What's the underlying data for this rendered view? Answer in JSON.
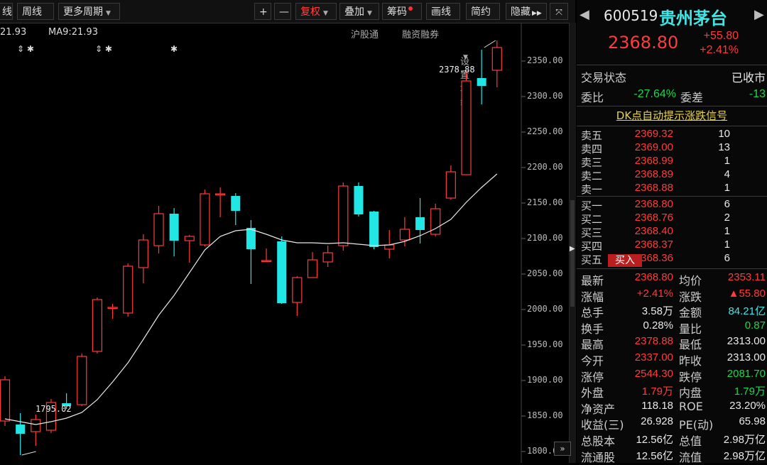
{
  "toolbar": {
    "items": [
      "线",
      "周线",
      "更多周期",
      "+",
      "—",
      "复权",
      "叠加",
      "筹码",
      "画线",
      "简约",
      "隐藏"
    ],
    "expand_glyph": "▶▶"
  },
  "indicators": {
    "close_readout": "21.93",
    "ma_readout": "MA9:21.93",
    "links": [
      "沪股通",
      "融资融券",
      "设置均线"
    ]
  },
  "chart_data": {
    "type": "candlestick",
    "y_ticks": [
      "2350.00",
      "2300.00",
      "2250.00",
      "2200.00",
      "2150.00",
      "2100.00",
      "2050.00",
      "2000.00",
      "1950.00",
      "1900.00",
      "1850.00",
      "1800.00"
    ],
    "ylim": [
      1784,
      2404
    ],
    "high_note": "2378.88",
    "low_note": "1795.02",
    "candles": [
      {
        "o": 1843,
        "h": 1906,
        "l": 1836,
        "c": 1901
      },
      {
        "o": 1838,
        "h": 1854,
        "l": 1795,
        "c": 1825
      },
      {
        "o": 1828,
        "h": 1852,
        "l": 1808,
        "c": 1845
      },
      {
        "o": 1830,
        "h": 1874,
        "l": 1826,
        "c": 1869
      },
      {
        "o": 1868,
        "h": 1882,
        "l": 1860,
        "c": 1864
      },
      {
        "o": 1866,
        "h": 1938,
        "l": 1864,
        "c": 1934
      },
      {
        "o": 1941,
        "h": 2017,
        "l": 1938,
        "c": 2014
      },
      {
        "o": 2003,
        "h": 2008,
        "l": 1987,
        "c": 2003
      },
      {
        "o": 1995,
        "h": 2065,
        "l": 1990,
        "c": 2061
      },
      {
        "o": 2059,
        "h": 2106,
        "l": 2037,
        "c": 2098
      },
      {
        "o": 2090,
        "h": 2146,
        "l": 2079,
        "c": 2135
      },
      {
        "o": 2135,
        "h": 2143,
        "l": 2075,
        "c": 2097
      },
      {
        "o": 2097,
        "h": 2105,
        "l": 2066,
        "c": 2103
      },
      {
        "o": 2091,
        "h": 2169,
        "l": 2089,
        "c": 2163
      },
      {
        "o": 2162,
        "h": 2172,
        "l": 2130,
        "c": 2163
      },
      {
        "o": 2160,
        "h": 2164,
        "l": 2119,
        "c": 2139
      },
      {
        "o": 2115,
        "h": 2126,
        "l": 2036,
        "c": 2085
      },
      {
        "o": 2069,
        "h": 2086,
        "l": 2069,
        "c": 2069
      },
      {
        "o": 2096,
        "h": 2103,
        "l": 2008,
        "c": 2009
      },
      {
        "o": 2010,
        "h": 2047,
        "l": 1991,
        "c": 2045
      },
      {
        "o": 2045,
        "h": 2081,
        "l": 2045,
        "c": 2070
      },
      {
        "o": 2067,
        "h": 2090,
        "l": 2060,
        "c": 2080
      },
      {
        "o": 2090,
        "h": 2179,
        "l": 2083,
        "c": 2174
      },
      {
        "o": 2174,
        "h": 2179,
        "l": 2131,
        "c": 2134
      },
      {
        "o": 2138,
        "h": 2139,
        "l": 2085,
        "c": 2088
      },
      {
        "o": 2085,
        "h": 2112,
        "l": 2072,
        "c": 2091
      },
      {
        "o": 2098,
        "h": 2130,
        "l": 2089,
        "c": 2113
      },
      {
        "o": 2130,
        "h": 2157,
        "l": 2093,
        "c": 2112
      },
      {
        "o": 2106,
        "h": 2149,
        "l": 2103,
        "c": 2142
      },
      {
        "o": 2157,
        "h": 2203,
        "l": 2155,
        "c": 2194
      },
      {
        "o": 2190,
        "h": 2334,
        "l": 2190,
        "c": 2322
      },
      {
        "o": 2326,
        "h": 2366,
        "l": 2289,
        "c": 2315
      },
      {
        "o": 2337,
        "h": 2379,
        "l": 2313,
        "c": 2369
      }
    ],
    "ma": [
      1846,
      1842,
      1838,
      1842,
      1847,
      1855,
      1873,
      1898,
      1925,
      1958,
      1992,
      2020,
      2052,
      2084,
      2103,
      2111,
      2113,
      2106,
      2098,
      2094,
      2094,
      2093,
      2094,
      2092,
      2090,
      2091,
      2096,
      2104,
      2114,
      2127,
      2151,
      2172,
      2191
    ]
  },
  "quote": {
    "code": "600519",
    "name": "贵州茅台",
    "price": "2368.80",
    "change": "+55.80",
    "change_pct": "+2.41%",
    "status_label": "交易状态",
    "status_value": "已收市",
    "weibi_label": "委比",
    "weibi_value": "-27.64%",
    "weicha_label": "委差",
    "weicha_value": "-13",
    "signal_link": "DK点自动提示涨跌信号"
  },
  "order_book": {
    "sell": [
      {
        "label": "卖五",
        "price": "2369.32",
        "vol": "10"
      },
      {
        "label": "卖四",
        "price": "2369.00",
        "vol": "13"
      },
      {
        "label": "卖三",
        "price": "2368.99",
        "vol": "1"
      },
      {
        "label": "卖二",
        "price": "2368.89",
        "vol": "4"
      },
      {
        "label": "卖一",
        "price": "2368.88",
        "vol": "1"
      }
    ],
    "buy": [
      {
        "label": "买一",
        "price": "2368.80",
        "vol": "6"
      },
      {
        "label": "买二",
        "price": "2368.76",
        "vol": "2"
      },
      {
        "label": "买三",
        "price": "2368.40",
        "vol": "1"
      },
      {
        "label": "买四",
        "price": "2368.37",
        "vol": "1"
      },
      {
        "label": "买五",
        "price": "2368.36",
        "vol": "6"
      }
    ],
    "buy_button": "买入"
  },
  "stats": [
    {
      "l1": "最新",
      "v1": "2368.80",
      "c1": "red",
      "l2": "均价",
      "v2": "2353.11",
      "c2": "red"
    },
    {
      "l1": "涨幅",
      "v1": "+2.41%",
      "c1": "red",
      "l2": "涨跌",
      "v2": "▲55.80",
      "c2": "red"
    },
    {
      "l1": "总手",
      "v1": "3.58万",
      "c1": "white",
      "l2": "金额",
      "v2": "84.21亿",
      "c2": "cyan"
    },
    {
      "l1": "换手",
      "v1": "0.28%",
      "c1": "white",
      "l2": "量比",
      "v2": "0.87",
      "c2": "green"
    },
    {
      "l1": "最高",
      "v1": "2378.88",
      "c1": "red",
      "l2": "最低",
      "v2": "2313.00",
      "c2": "white"
    },
    {
      "l1": "今开",
      "v1": "2337.00",
      "c1": "red",
      "l2": "昨收",
      "v2": "2313.00",
      "c2": "white"
    },
    {
      "l1": "涨停",
      "v1": "2544.30",
      "c1": "red",
      "l2": "跌停",
      "v2": "2081.70",
      "c2": "green"
    },
    {
      "l1": "外盘",
      "v1": "1.79万",
      "c1": "red",
      "l2": "内盘",
      "v2": "1.79万",
      "c2": "green"
    },
    {
      "l1": "净资产",
      "v1": "118.18",
      "c1": "white",
      "l2": "ROE",
      "v2": "23.20%",
      "c2": "white"
    },
    {
      "l1": "收益(三)",
      "v1": "26.928",
      "c1": "white",
      "l2": "PE(动)",
      "v2": "65.98",
      "c2": "white"
    },
    {
      "l1": "总股本",
      "v1": "12.56亿",
      "c1": "white",
      "l2": "总值",
      "v2": "2.98万亿",
      "c2": "white"
    },
    {
      "l1": "流通股",
      "v1": "12.56亿",
      "c1": "white",
      "l2": "流值",
      "v2": "2.98万亿",
      "c2": "white"
    }
  ],
  "colors": {
    "up": "#ff3b3b",
    "down": "#20e6e6",
    "ma": "#e8e8e8"
  }
}
